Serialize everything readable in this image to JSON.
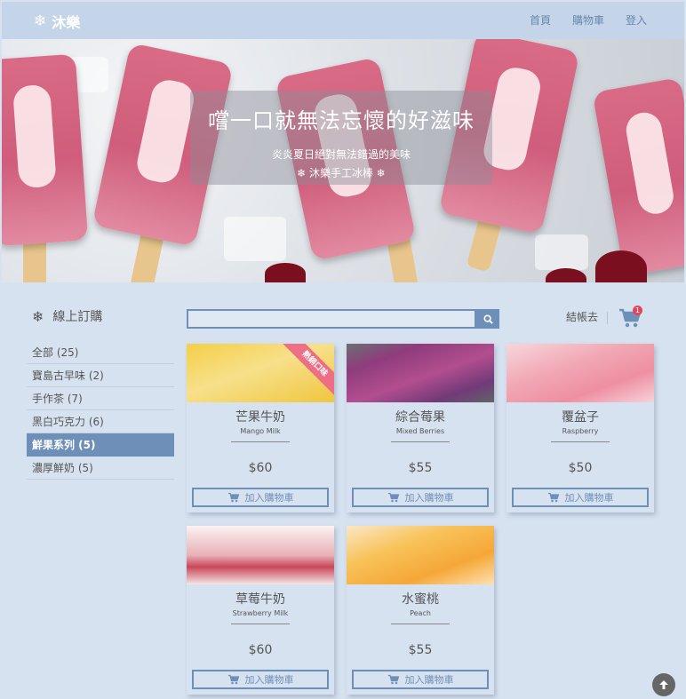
{
  "navbar": {
    "brand": "沐樂",
    "links": [
      "首頁",
      "購物車",
      "登入"
    ]
  },
  "hero": {
    "title": "嚐一口就無法忘懷的好滋味",
    "subtitle": "炎炎夏日絕對無法錯過的美味",
    "tagline": "❄ 沐樂手工冰棒 ❄"
  },
  "sidebar": {
    "heading": "線上訂購",
    "items": [
      {
        "label": "全部 (25)",
        "active": false
      },
      {
        "label": "寶島古早味 (2)",
        "active": false
      },
      {
        "label": "手作茶 (7)",
        "active": false
      },
      {
        "label": "黑白巧克力 (6)",
        "active": false
      },
      {
        "label": "鮮果系列 (5)",
        "active": true
      },
      {
        "label": "濃厚鮮奶 (5)",
        "active": false
      }
    ]
  },
  "search": {
    "value": "",
    "placeholder": ""
  },
  "cart": {
    "checkout_label": "結帳去",
    "count": "1"
  },
  "products": [
    {
      "name": "芒果牛奶",
      "ename": "Mango Milk",
      "price": "$60",
      "ribbon": "熱銷口味",
      "button": "加入購物車"
    },
    {
      "name": "綜合莓果",
      "ename": "Mixed Berries",
      "price": "$55",
      "ribbon": "",
      "button": "加入購物車"
    },
    {
      "name": "覆盆子",
      "ename": "Raspberry",
      "price": "$50",
      "ribbon": "",
      "button": "加入購物車"
    },
    {
      "name": "草莓牛奶",
      "ename": "Strawberry Milk",
      "price": "$60",
      "ribbon": "",
      "button": "加入購物車"
    },
    {
      "name": "水蜜桃",
      "ename": "Peach",
      "price": "$55",
      "ribbon": "",
      "button": "加入購物車"
    }
  ],
  "icons": {
    "brand": "snowflake-icon",
    "sidebar": "snowflake-icon",
    "search": "search-icon",
    "cart": "cart-icon",
    "add_to_cart": "cart-icon",
    "back_to_top": "arrow-up-icon"
  },
  "colors": {
    "page_bg": "#d7e2f0",
    "navbar_bg": "#c4d5ea",
    "accent": "#6e8fb8",
    "badge": "#e2465c",
    "ribbon": "#ec6f86"
  }
}
